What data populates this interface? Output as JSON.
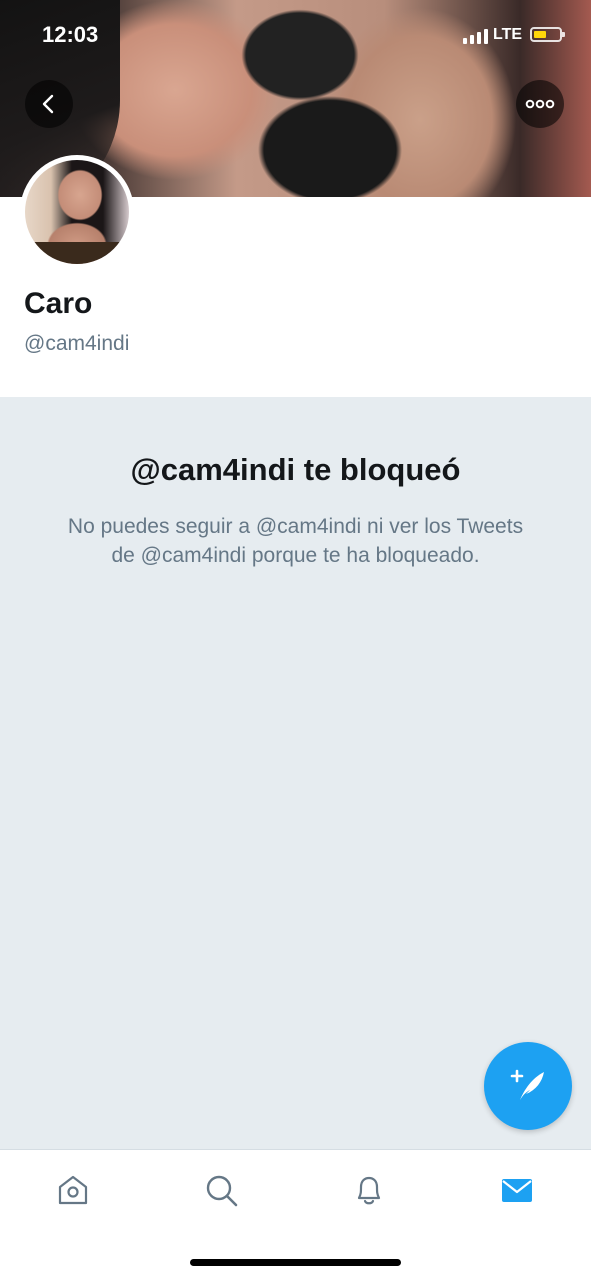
{
  "status_bar": {
    "time": "12:03",
    "network": "LTE"
  },
  "header": {
    "back_icon": "chevron-left-icon",
    "more_icon": "ellipsis-icon"
  },
  "profile": {
    "name": "Caro",
    "handle": "@cam4indi"
  },
  "blocked": {
    "title": "@cam4indi te bloqueó",
    "message": "No puedes seguir a @cam4indi ni ver los Tweets de @cam4indi porque te ha bloqueado."
  },
  "fab": {
    "icon": "compose-tweet-icon"
  },
  "tabs": [
    {
      "name": "home",
      "icon": "home-icon"
    },
    {
      "name": "search",
      "icon": "search-icon"
    },
    {
      "name": "notifications",
      "icon": "bell-icon"
    },
    {
      "name": "messages",
      "icon": "mail-icon",
      "active": true
    }
  ],
  "colors": {
    "accent": "#1da1f2",
    "secondary_text": "#657786",
    "background": "#e6ecf0"
  }
}
